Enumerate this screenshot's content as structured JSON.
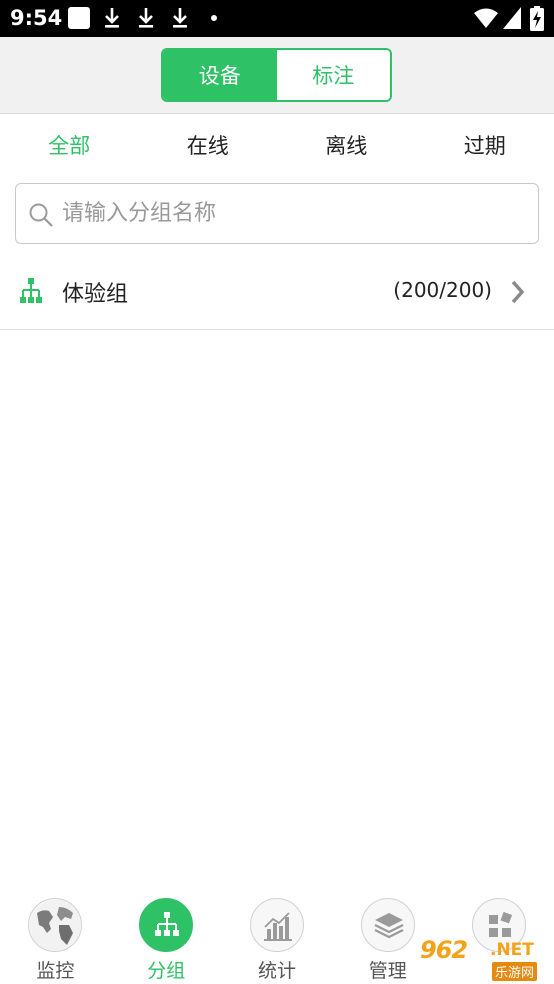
{
  "status_bar": {
    "time": "9:54"
  },
  "header": {
    "segments": [
      {
        "label": "设备",
        "active": true
      },
      {
        "label": "标注",
        "active": false
      }
    ]
  },
  "filters": [
    {
      "label": "全部",
      "active": true
    },
    {
      "label": "在线",
      "active": false
    },
    {
      "label": "离线",
      "active": false
    },
    {
      "label": "过期",
      "active": false
    }
  ],
  "search": {
    "placeholder": "请输入分组名称",
    "value": ""
  },
  "groups": [
    {
      "name": "体验组",
      "count": "(200/200)"
    }
  ],
  "bottom_nav": [
    {
      "label": "监控",
      "icon": "globe-icon",
      "active": false
    },
    {
      "label": "分组",
      "icon": "org-tree-icon",
      "active": true
    },
    {
      "label": "统计",
      "icon": "bar-chart-icon",
      "active": false
    },
    {
      "label": "管理",
      "icon": "layers-icon",
      "active": false
    },
    {
      "label": "",
      "icon": "grid-icon",
      "active": false
    }
  ],
  "watermark": {
    "number": "962",
    "domain": ".NET",
    "text": "乐游网"
  },
  "colors": {
    "accent": "#2ec166",
    "status_bar": "#000000",
    "header_bg": "#f1f1f1"
  }
}
